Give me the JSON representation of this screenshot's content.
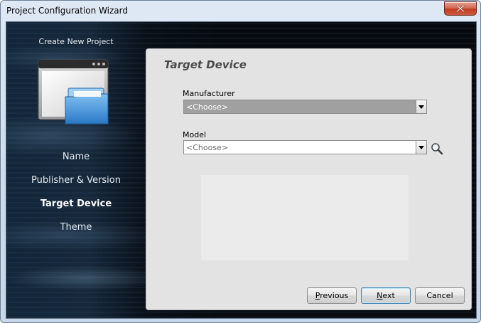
{
  "window": {
    "title": "Project Configuration Wizard"
  },
  "sidebar": {
    "header": "Create New Project",
    "items": [
      {
        "label": "Name",
        "active": false
      },
      {
        "label": "Publisher & Version",
        "active": false
      },
      {
        "label": "Target Device",
        "active": true
      },
      {
        "label": "Theme",
        "active": false
      }
    ]
  },
  "panel": {
    "title": "Target Device",
    "manufacturer": {
      "label": "Manufacturer",
      "value": "<Choose>"
    },
    "model": {
      "label": "Model",
      "value": "<Choose>"
    }
  },
  "buttons": {
    "previous": {
      "prefix": "",
      "access_key": "P",
      "rest": "revious"
    },
    "next": {
      "prefix": "",
      "access_key": "N",
      "rest": "ext"
    },
    "cancel": "Cancel"
  },
  "icons": {
    "close": "close-icon",
    "project": "project-folder-icon",
    "search": "search-icon",
    "dropdown": "chevron-down-icon"
  }
}
